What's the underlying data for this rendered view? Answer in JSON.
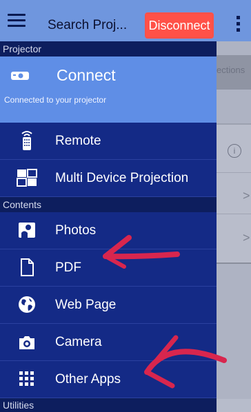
{
  "appbar": {
    "title": "Search Proj...",
    "disconnect_label": "Disconnect",
    "menu_icon": "hamburger-menu-icon",
    "overflow_icon": "more-vert-icon",
    "colors": {
      "bar": "#6f96de",
      "disconnect": "#ff5148"
    }
  },
  "background": {
    "partial_text": "ections",
    "info_glyph": "i",
    "chevron": ">"
  },
  "drawer": {
    "projector_section": "Projector",
    "connect": {
      "label": "Connect",
      "subtitle": "Connected to your projector",
      "icon": "projector-icon"
    },
    "remote": {
      "label": "Remote",
      "icon": "remote-icon"
    },
    "multi": {
      "label": "Multi Device Projection",
      "icon": "multi-device-icon"
    },
    "contents_section": "Contents",
    "photos": {
      "label": "Photos",
      "icon": "photo-icon"
    },
    "pdf": {
      "label": "PDF",
      "icon": "document-icon"
    },
    "web": {
      "label": "Web Page",
      "icon": "globe-icon"
    },
    "camera": {
      "label": "Camera",
      "icon": "camera-icon"
    },
    "other": {
      "label": "Other Apps",
      "icon": "apps-grid-icon"
    },
    "utilities_section": "Utilities",
    "colors": {
      "drawer": "#142a86",
      "selected": "#5f8ee6",
      "section": "#0d1e5e"
    }
  },
  "annotations": {
    "arrow_color": "#d8264e"
  }
}
